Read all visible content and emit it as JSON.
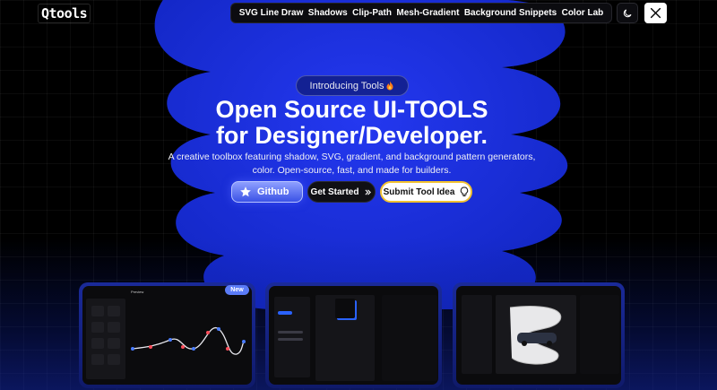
{
  "brand": {
    "logo_text": "Qtools"
  },
  "nav": {
    "items": [
      {
        "label": "SVG Line Draw"
      },
      {
        "label": "Shadows"
      },
      {
        "label": "Clip-Path"
      },
      {
        "label": "Mesh-Gradient"
      },
      {
        "label": "Background Snippets"
      },
      {
        "label": "Color Lab"
      }
    ],
    "theme_icon": "moon-icon",
    "social_icon": "x-logo-icon"
  },
  "hero": {
    "badge_text": "Introducing Tools",
    "badge_icon": "fire-icon",
    "title_line1": "Open Source UI-TOOLS",
    "title_line2": "for Designer/Developer.",
    "subtitle": "A creative toolbox featuring shadow, SVG, gradient, and background pattern generators, color. Open-source, fast, and made for builders."
  },
  "buttons": {
    "github_label": "Github",
    "start_label": "Get Started",
    "submit_label": "Submit Tool Idea"
  },
  "previews": {
    "new_badge": "New",
    "card1_title": "Preview"
  },
  "colors": {
    "accent_blue": "#1e34e8",
    "button_glow": "#3b52e6",
    "submit_border": "#f2c230"
  }
}
